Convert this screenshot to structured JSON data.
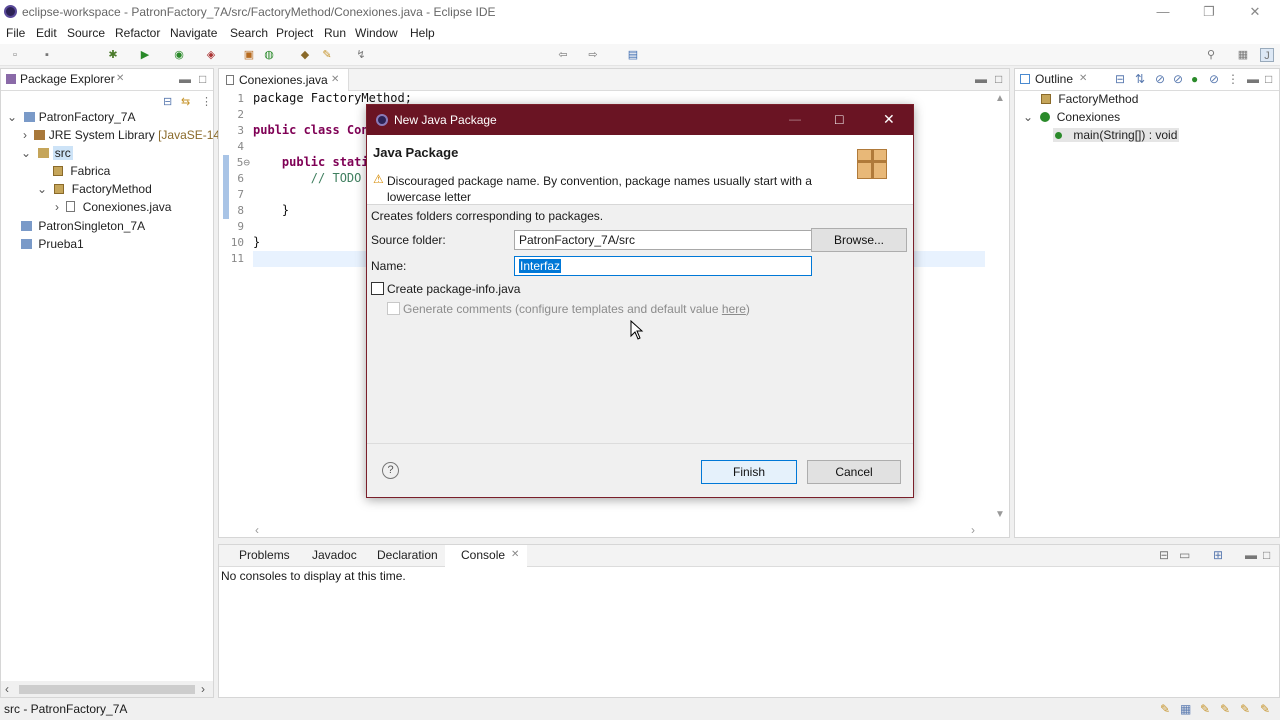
{
  "window": {
    "title": "eclipse-workspace - PatronFactory_7A/src/FactoryMethod/Conexiones.java - Eclipse IDE",
    "minimize": "—",
    "restore": "❐",
    "close": "✕"
  },
  "menu": [
    "File",
    "Edit",
    "Source",
    "Refactor",
    "Navigate",
    "Search",
    "Project",
    "Run",
    "Window",
    "Help"
  ],
  "package_explorer": {
    "tab": "Package Explorer",
    "items": [
      {
        "label": "PatronFactory_7A",
        "icon": "project-icon",
        "toggle": "⌄"
      },
      {
        "label": "JRE System Library",
        "suffix": "[JavaSE-14]",
        "icon": "library-icon",
        "toggle": "›"
      },
      {
        "label": "src",
        "icon": "source-folder-icon",
        "toggle": "⌄"
      },
      {
        "label": "Fabrica",
        "icon": "package-icon",
        "toggle": ""
      },
      {
        "label": "FactoryMethod",
        "icon": "package-icon",
        "toggle": "⌄"
      },
      {
        "label": "Conexiones.java",
        "icon": "java-file-icon",
        "toggle": "›"
      },
      {
        "label": "PatronSingleton_7A",
        "icon": "project-icon",
        "toggle": ""
      },
      {
        "label": "Prueba1",
        "icon": "project-icon",
        "toggle": ""
      }
    ]
  },
  "editor": {
    "tab": "Conexiones.java",
    "line_numbers": [
      "1",
      "2",
      "3",
      "4",
      "5⊖",
      "6",
      "7",
      "8",
      "9",
      "10",
      "11"
    ],
    "lines": [
      "package FactoryMethod;",
      "",
      "public class Con",
      "",
      "    public stati",
      "        // TODO",
      "",
      "    }",
      "",
      "}",
      ""
    ]
  },
  "outline": {
    "tab": "Outline",
    "items": [
      "FactoryMethod",
      "Conexiones",
      "main(String[]) : void"
    ]
  },
  "console": {
    "tabs": [
      "Problems",
      "Javadoc",
      "Declaration",
      "Console"
    ],
    "message": "No consoles to display at this time."
  },
  "dialog": {
    "title": "New Java Package",
    "heading": "Java Package",
    "warning": "Discouraged package name. By convention, package names usually start with a lowercase letter",
    "description": "Creates folders corresponding to packages.",
    "source_folder_label": "Source folder:",
    "source_folder_value": "PatronFactory_7A/src",
    "browse_label": "Browse...",
    "name_label": "Name:",
    "name_value": "Interfaz",
    "create_info_label": "Create package-info.java",
    "generate_comments_label": "Generate comments (configure templates and default value ",
    "here_link": "here",
    "generate_comments_suffix": ")",
    "finish_label": "Finish",
    "cancel_label": "Cancel"
  },
  "status": {
    "text": "src - PatronFactory_7A"
  },
  "colors": {
    "dialog_title": "#6a1423",
    "selection": "#0078d7",
    "keyword": "#7f0055"
  }
}
